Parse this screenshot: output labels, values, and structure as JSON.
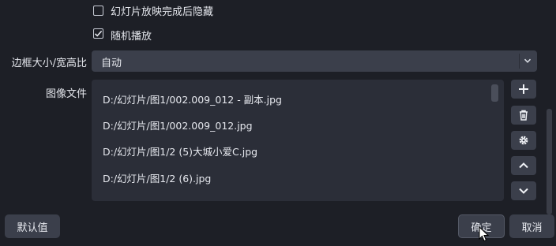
{
  "options": {
    "hide_after_slideshow": {
      "label": "幻灯片放映完成后隐藏",
      "checked": false
    },
    "random_play": {
      "label": "随机播放",
      "checked": true
    }
  },
  "bounding_size": {
    "label": "边框大小/宽高比",
    "value": "自动"
  },
  "image_files": {
    "label": "图像文件",
    "items": [
      "D:/幻灯片/图1/002.009_012 - 副本.jpg",
      "D:/幻灯片/图1/002.009_012.jpg",
      "D:/幻灯片/图1/2 (5)大城小爱C.jpg",
      "D:/幻灯片/图1/2 (6).jpg"
    ]
  },
  "side_buttons": [
    "plus-icon",
    "trash-icon",
    "gear-icon",
    "chevron-up-icon",
    "chevron-down-icon"
  ],
  "footer": {
    "defaults_label": "默认值",
    "ok_label": "确定",
    "cancel_label": "取消"
  }
}
